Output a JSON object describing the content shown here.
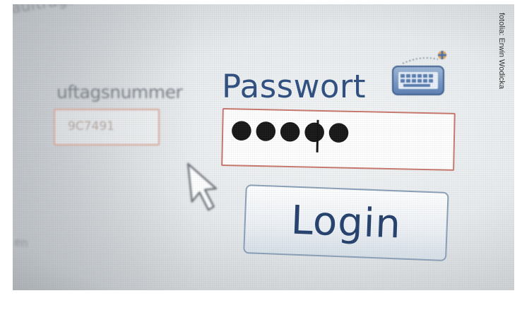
{
  "background": {
    "header_text": "auftragsnummer und",
    "side_text": "en"
  },
  "form": {
    "left_field": {
      "label": "uftagsnummer",
      "value": "9C7491"
    },
    "password": {
      "label": "Passwort",
      "value": "●●●●●",
      "masked_length": 5
    },
    "login_button_label": "Login"
  },
  "icons": {
    "keyboard": "virtual-keyboard-icon",
    "cursor": "mouse-pointer-icon"
  },
  "colors": {
    "label_blue": "#2f4e80",
    "field_border": "#c9786d",
    "button_border": "#8aa0b8"
  },
  "photo_credit": "fotolia: Erwin Wodicka"
}
